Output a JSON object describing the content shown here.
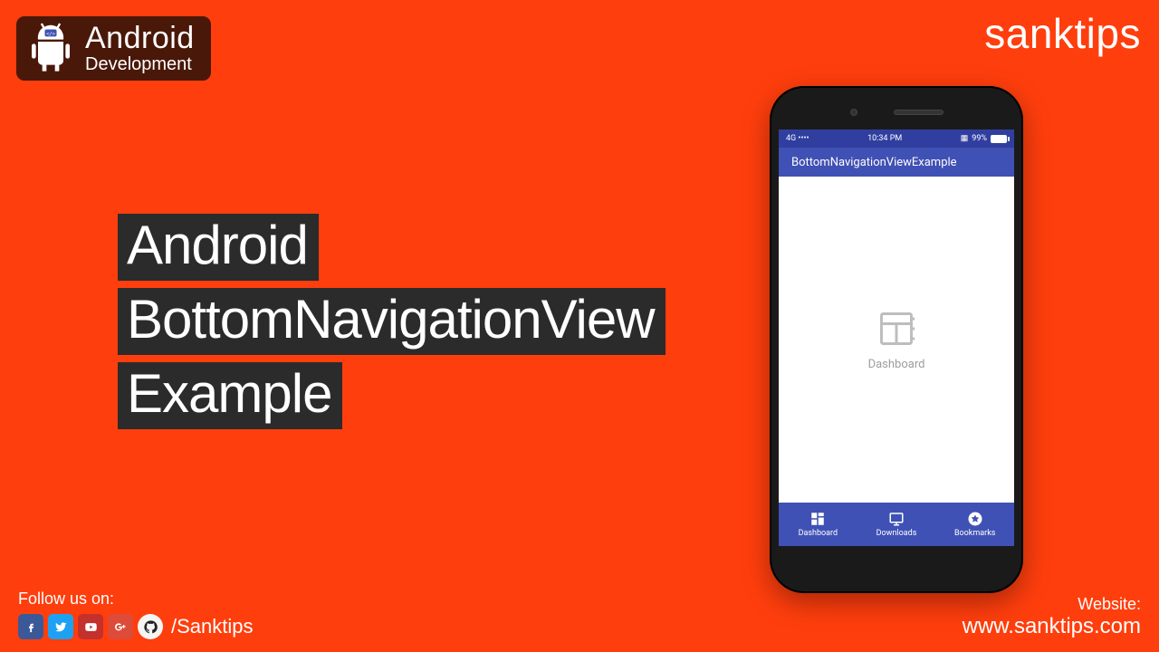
{
  "header": {
    "badge_title": "Android",
    "badge_subtitle": "Development",
    "brand_light": "sank",
    "brand_bold": "tips"
  },
  "title": {
    "line1": "Android",
    "line2": "BottomNavigationView",
    "line3": "Example"
  },
  "phone": {
    "status": {
      "net": "4G",
      "time": "10:34 PM",
      "batt_pct": "99%"
    },
    "appbar_title": "BottomNavigationViewExample",
    "content_label": "Dashboard",
    "nav": [
      {
        "label": "Dashboard"
      },
      {
        "label": "Downloads"
      },
      {
        "label": "Bookmarks"
      }
    ]
  },
  "footer": {
    "follow_label": "Follow us on:",
    "handle": "/Sanktips",
    "website_label": "Website:",
    "website_url": "www.sanktips.com"
  }
}
